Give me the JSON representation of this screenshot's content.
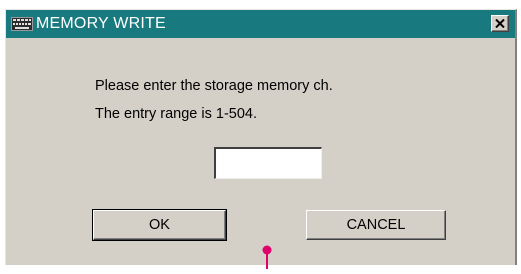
{
  "window": {
    "title": "MEMORY WRITE",
    "icon": "keyboard-icon",
    "close_icon": "close-icon"
  },
  "message": {
    "line1": "Please enter the storage memory ch.",
    "line2": "The entry range is 1-504."
  },
  "entry": {
    "value": ""
  },
  "buttons": {
    "ok_label": "OK",
    "cancel_label": "CANCEL"
  },
  "colors": {
    "titlebar": "#187a7e",
    "dialog_face": "#d4d0c8",
    "pointer": "#e0006a"
  }
}
